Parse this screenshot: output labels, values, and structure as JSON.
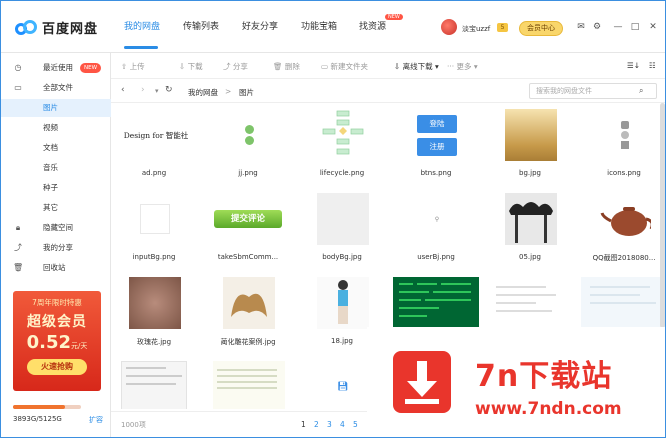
{
  "app": {
    "name": "百度网盘"
  },
  "nav": {
    "tabs": [
      "我的网盘",
      "传输列表",
      "好友分享",
      "功能宝箱",
      "找资源"
    ],
    "new_badge": "NEW"
  },
  "user": {
    "name": "淡宝uzzf",
    "level": "5",
    "member_button": "会员中心"
  },
  "sidebar": {
    "items": [
      {
        "label": "最近使用",
        "badge": "NEW",
        "icon": "clock-icon"
      },
      {
        "label": "全部文件",
        "icon": "folder-icon"
      },
      {
        "label": "图片"
      },
      {
        "label": "视频"
      },
      {
        "label": "文档"
      },
      {
        "label": "音乐"
      },
      {
        "label": "种子"
      },
      {
        "label": "其它"
      },
      {
        "label": "隐藏空间",
        "icon": "lock-icon"
      },
      {
        "label": "我的分享",
        "icon": "share-icon"
      },
      {
        "label": "回收站",
        "icon": "trash-icon"
      }
    ],
    "promo": {
      "line1": "7周年限时特惠",
      "line2": "超级会员",
      "price": "0.52",
      "unit": "元/天",
      "button": "火速抢购"
    },
    "quota": {
      "text": "3893G/5125G",
      "fraction": 0.76,
      "expand": "扩容"
    }
  },
  "toolbar": {
    "buttons": [
      "上传",
      "下载",
      "分享",
      "删除",
      "新建文件夹",
      "离线下载",
      "更多"
    ]
  },
  "address": {
    "crumbs": [
      "我的网盘",
      ">",
      "图片"
    ],
    "search_placeholder": "搜索我的网盘文件"
  },
  "files": [
    {
      "name": "ad.png",
      "preview_text": "Design for 智能社"
    },
    {
      "name": "jj.png"
    },
    {
      "name": "lifecycle.png"
    },
    {
      "name": "btns.png",
      "btn1": "登陆",
      "btn2": "注册"
    },
    {
      "name": "bg.jpg"
    },
    {
      "name": "icons.png"
    },
    {
      "name": "inputBg.png"
    },
    {
      "name": "takeSbmComm...",
      "preview_text": "提交评论"
    },
    {
      "name": "bodyBg.jpg"
    },
    {
      "name": "userBj.png"
    },
    {
      "name": "05.jpg"
    },
    {
      "name": "QQ截图2018080..."
    },
    {
      "name": "玫瑰花.jpg"
    },
    {
      "name": "蔺化雕花案例.jpg"
    },
    {
      "name": "18.jpg"
    },
    {
      "name": ""
    },
    {
      "name": ""
    },
    {
      "name": ""
    },
    {
      "name": ""
    },
    {
      "name": ""
    },
    {
      "name": ""
    }
  ],
  "footer": {
    "total": "1000项",
    "pages": [
      "1",
      "2",
      "3",
      "4",
      "5"
    ]
  },
  "watermark": {
    "title": "7n下载站",
    "url": "www.7ndn.com"
  },
  "colors": {
    "accent": "#2a8ce5",
    "brand_red": "#e9352c",
    "promo": "#f15a3a"
  }
}
